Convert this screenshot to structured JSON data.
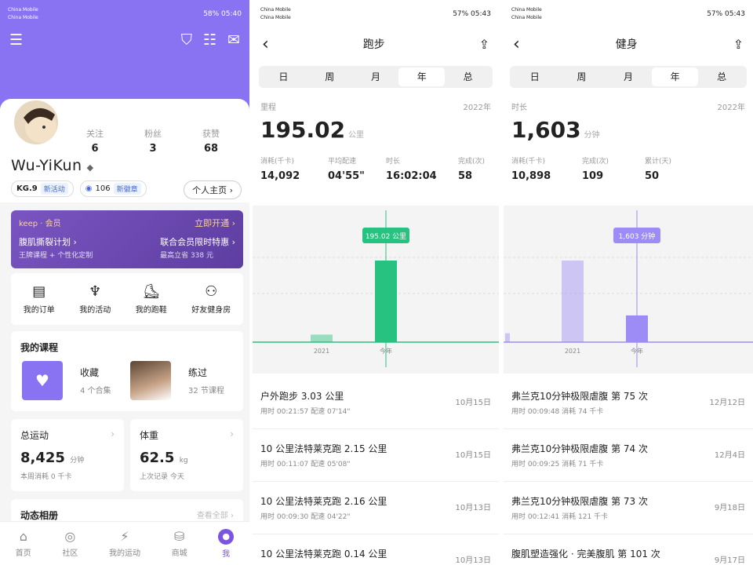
{
  "status": {
    "carrier1": "China Mobile",
    "carrier2": "China Mobile",
    "s1_right": "58% 05:40",
    "s2_right": "57% 05:43",
    "s3_right": "57% 05:43"
  },
  "profile": {
    "username": "Wu-YiKun",
    "stats": [
      {
        "label": "关注",
        "value": "6"
      },
      {
        "label": "粉丝",
        "value": "3"
      },
      {
        "label": "获赞",
        "value": "68"
      }
    ],
    "level": "KG.9",
    "level_tag": "新活动",
    "points": "106",
    "points_tag": "新徽章",
    "home_btn": "个人主页 ›"
  },
  "vip": {
    "brand": "keep · 会员",
    "open": "立即开通 ›",
    "plan1": "腹肌撕裂计划 ›",
    "plan1_sub": "王牌课程 + 个性化定制",
    "plan2": "联合会员限时特惠 ›",
    "plan2_sub": "最高立省 338 元"
  },
  "quick": [
    {
      "icon": "clipboard-icon",
      "g": "▤",
      "label": "我的订单"
    },
    {
      "icon": "trophy-icon",
      "g": "♆",
      "label": "我的活动"
    },
    {
      "icon": "shoe-icon",
      "g": "⛸",
      "label": "我的跑鞋"
    },
    {
      "icon": "people-icon",
      "g": "⚇",
      "label": "好友健身房"
    }
  ],
  "course": {
    "title": "我的课程",
    "fav": "收藏",
    "fav_sub": "4 个合集",
    "done": "练过",
    "done_sub": "32 节课程"
  },
  "total": {
    "title": "总运动",
    "value": "8,425",
    "unit": "分钟",
    "sub": "本周消耗 0 千卡"
  },
  "weight": {
    "title": "体重",
    "value": "62.5",
    "unit": "kg",
    "sub": "上次记录 今天"
  },
  "album": {
    "title": "动态相册",
    "link": "查看全部 ›"
  },
  "tabs": [
    {
      "icon": "home-icon",
      "g": "⌂",
      "label": "首页"
    },
    {
      "icon": "community-icon",
      "g": "◎",
      "label": "社区"
    },
    {
      "icon": "activity-icon",
      "g": "⚡",
      "label": "我的运动"
    },
    {
      "icon": "shop-icon",
      "g": "⛁",
      "label": "商城"
    },
    {
      "icon": "me-icon",
      "g": "●",
      "label": "我"
    }
  ],
  "run": {
    "title": "跑步",
    "segments": [
      "日",
      "周",
      "月",
      "年",
      "总"
    ],
    "seg_on": 3,
    "label": "里程",
    "year": "2022年",
    "value": "195.02",
    "unit": "公里",
    "metrics": [
      {
        "label": "消耗(千卡)",
        "value": "14,092"
      },
      {
        "label": "平均配速",
        "value": "04'55\""
      },
      {
        "label": "时长",
        "value": "16:02:04"
      },
      {
        "label": "完成(次)",
        "value": "58"
      }
    ],
    "tooltip": "195.02 公里",
    "items": [
      {
        "name": "户外跑步 3.03 公里",
        "detail": "用时 00:21:57   配速 07'14\"",
        "date": "10月15日"
      },
      {
        "name": "10 公里法特莱克跑 2.15 公里",
        "detail": "用时 00:11:07   配速 05'08\"",
        "date": "10月15日"
      },
      {
        "name": "10 公里法特莱克跑 2.16 公里",
        "detail": "用时 00:09:30   配速 04'22\"",
        "date": "10月13日"
      },
      {
        "name": "10 公里法特莱克跑 0.14 公里",
        "detail": "",
        "date": "10月13日"
      }
    ]
  },
  "fit": {
    "title": "健身",
    "segments": [
      "日",
      "周",
      "月",
      "年",
      "总"
    ],
    "seg_on": 3,
    "label": "时长",
    "year": "2022年",
    "value": "1,603",
    "unit": "分钟",
    "metrics": [
      {
        "label": "消耗(千卡)",
        "value": "10,898"
      },
      {
        "label": "完成(次)",
        "value": "109"
      },
      {
        "label": "累计(天)",
        "value": "50"
      }
    ],
    "tooltip": "1,603 分钟",
    "items": [
      {
        "name": "弗兰克10分钟极限虐腹 第 75 次",
        "detail": "用时 00:09:48   消耗 74 千卡",
        "date": "12月12日"
      },
      {
        "name": "弗兰克10分钟极限虐腹 第 74 次",
        "detail": "用时 00:09:25   消耗 71 千卡",
        "date": "12月4日"
      },
      {
        "name": "弗兰克10分钟极限虐腹 第 73 次",
        "detail": "用时 00:12:41   消耗 121 千卡",
        "date": "9月18日"
      },
      {
        "name": "腹肌塑造强化 · 完美腹肌 第 101 次",
        "detail": "",
        "date": "9月17日"
      }
    ]
  },
  "chart_data": [
    {
      "type": "bar",
      "title": "",
      "categories": [
        "",
        "2021",
        "今年"
      ],
      "values": [
        0,
        18,
        195.02
      ],
      "color": "#27c27f",
      "highlight": 2
    },
    {
      "type": "bar",
      "title": "",
      "categories": [
        "",
        "2021",
        "今年"
      ],
      "values": [
        120,
        1100,
        360
      ],
      "color": "#9d8cf5",
      "highlight": 2
    }
  ]
}
